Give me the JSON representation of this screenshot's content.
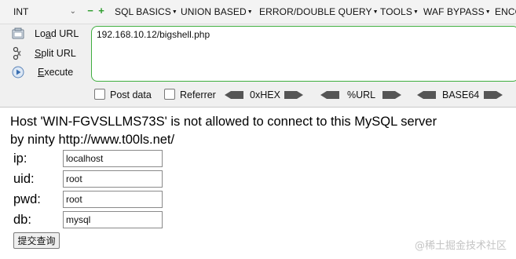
{
  "menubar": {
    "type_select": "INT",
    "minus": "−",
    "plus": "+",
    "items": [
      "SQL BASICS",
      "UNION BASED",
      "ERROR/DOUBLE QUERY",
      "TOOLS",
      "WAF BYPASS",
      "ENCO"
    ]
  },
  "hackbar": {
    "load_url_pre": "Lo",
    "load_url_key": "a",
    "load_url_post": "d URL",
    "split_url_key": "S",
    "split_url_post": "plit URL",
    "execute_key": "E",
    "execute_post": "xecute",
    "url_value": "192.168.10.12/bigshell.php",
    "post_data_label": "Post data",
    "referrer_label": "Referrer",
    "encoders": [
      "0xHEX",
      "%URL",
      "BASE64"
    ],
    "accent_color": "#3fae3f"
  },
  "page": {
    "error_message": "Host 'WIN-FGVSLLMS73S' is not allowed to connect to this MySQL server",
    "credit": "by ninty http://www.t00ls.net/",
    "form": {
      "ip_label": "ip:",
      "ip_value": "localhost",
      "uid_label": "uid:",
      "uid_value": "root",
      "pwd_label": "pwd:",
      "pwd_value": "root",
      "db_label": "db:",
      "db_value": "mysql",
      "submit_label": "提交查询"
    }
  },
  "watermark": "@稀土掘金技术社区"
}
